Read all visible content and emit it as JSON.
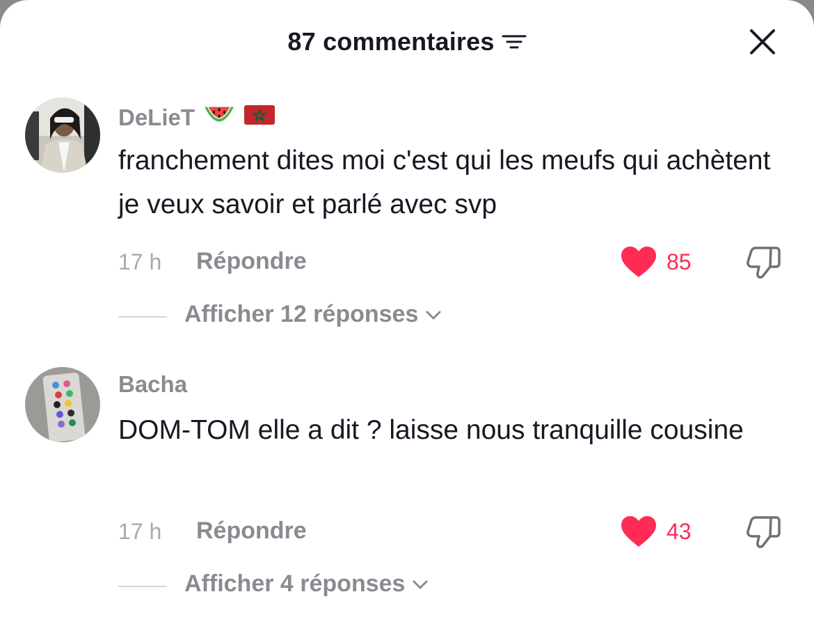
{
  "header": {
    "title": "87 commentaires",
    "sort_icon": "sort-lines-icon",
    "close_icon": "close-icon"
  },
  "comments": [
    {
      "username": "DeLieT",
      "badges": [
        "watermelon-emoji",
        "morocco-flag-emoji"
      ],
      "text": "franchement dites moi c'est qui les meufs qui achètent je veux savoir et parlé avec svp",
      "time": "17 h",
      "reply_label": "Répondre",
      "likes": "85",
      "replies_label": "Afficher 12 réponses"
    },
    {
      "username": "Bacha",
      "badges": [],
      "text": "DOM-TOM elle a dit ? laisse nous tranquille cousine",
      "time": "17 h",
      "reply_label": "Répondre",
      "likes": "43",
      "replies_label": "Afficher 4 réponses"
    }
  ],
  "colors": {
    "like": "#fe2c55",
    "text": "#161823",
    "secondary": "#8a8b91"
  }
}
